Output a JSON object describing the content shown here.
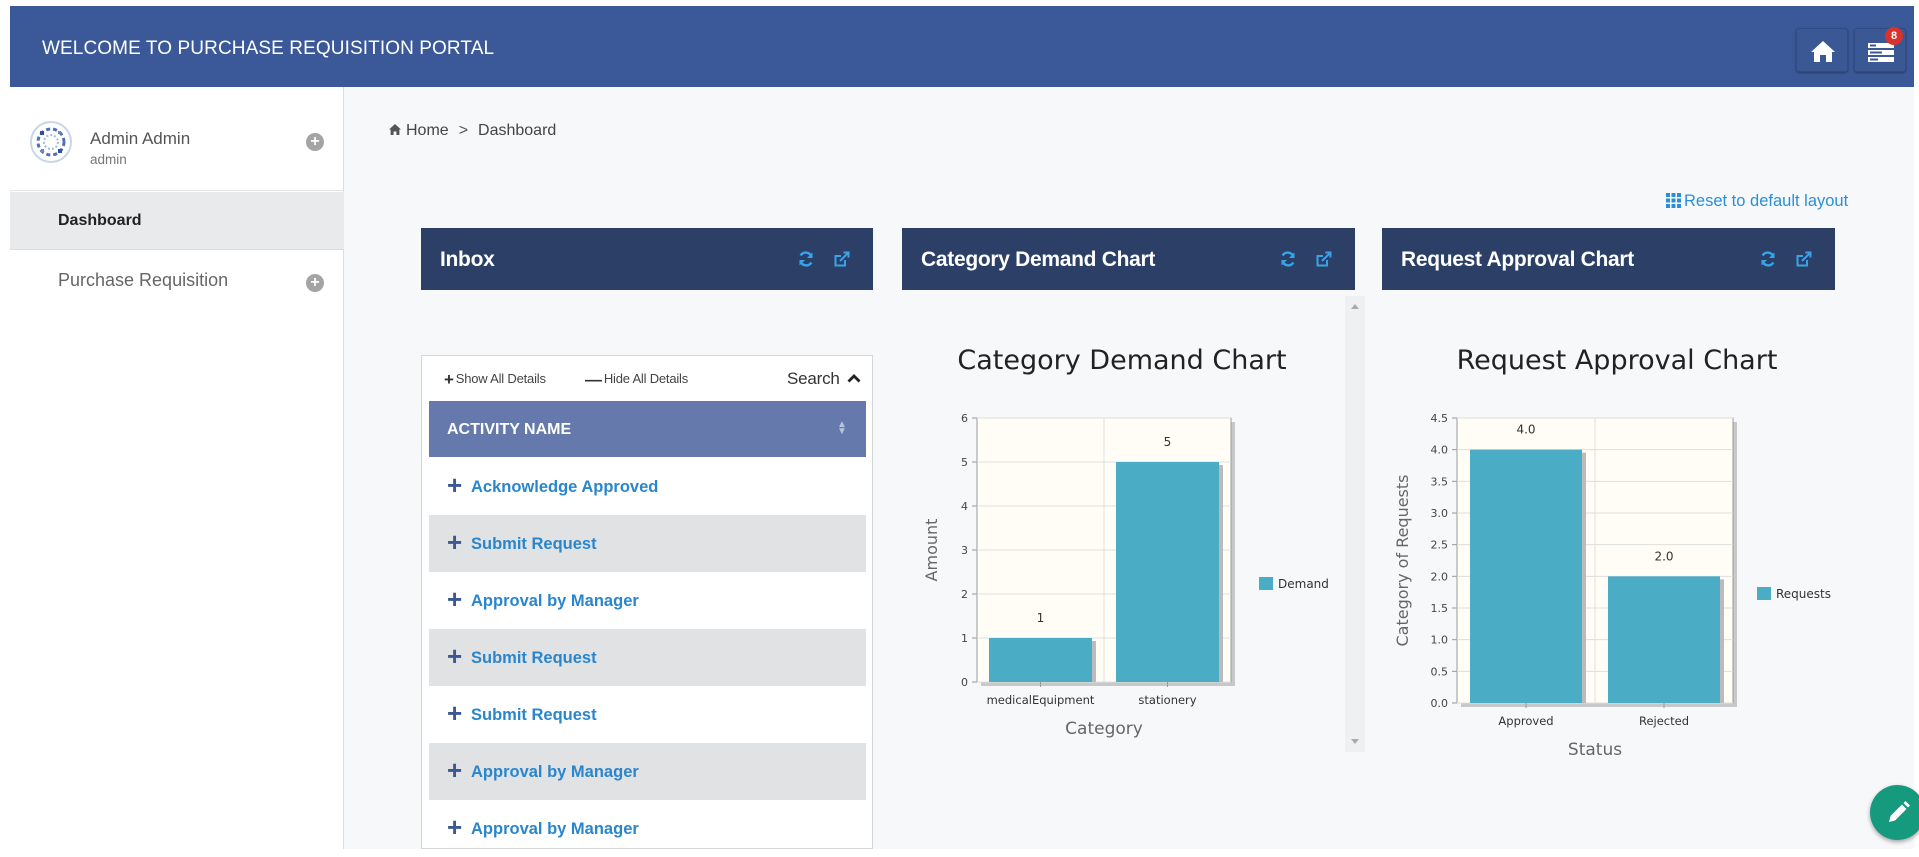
{
  "header": {
    "title": "WELCOME TO PURCHASE REQUISITION PORTAL",
    "notification_count": "8"
  },
  "sidebar": {
    "user": {
      "name": "Admin Admin",
      "role": "admin"
    },
    "items": [
      {
        "label": "Dashboard",
        "active": true
      },
      {
        "label": "Purchase Requisition",
        "active": false
      }
    ]
  },
  "breadcrumb": {
    "home": "Home",
    "current": "Dashboard"
  },
  "reset_layout": "Reset to default layout",
  "panels": {
    "inbox": {
      "title": "Inbox",
      "show_all": "Show All Details",
      "hide_all": "Hide All Details",
      "search": "Search",
      "column": "ACTIVITY NAME",
      "rows": [
        "Acknowledge Approved",
        "Submit Request",
        "Approval by Manager",
        "Submit Request",
        "Submit Request",
        "Approval by Manager",
        "Approval by Manager"
      ]
    },
    "category": {
      "title": "Category Demand Chart"
    },
    "approval": {
      "title": "Request Approval Chart"
    }
  },
  "colors": {
    "header": "#3b5998",
    "panel_header": "#2c4067",
    "bar": "#4bacc6",
    "link": "#2a86cc",
    "fab": "#159a7e"
  },
  "icons": [
    "home-icon",
    "tasks-icon",
    "refresh-icon",
    "external-link-icon",
    "th-icon",
    "plus-icon",
    "pencil-icon"
  ],
  "chart_data": [
    {
      "type": "bar",
      "title": "Category Demand Chart",
      "categories": [
        "medicalEquipment",
        "stationery"
      ],
      "series": [
        {
          "name": "Demand",
          "values": [
            1,
            5
          ]
        }
      ],
      "data_labels": [
        "1",
        "5"
      ],
      "xlabel": "Category",
      "ylabel": "Amount",
      "ylim": [
        0,
        6
      ],
      "yticks": [
        "0",
        "1",
        "2",
        "3",
        "4",
        "5",
        "6"
      ],
      "grid": true,
      "legend": "right"
    },
    {
      "type": "bar",
      "title": "Request Approval Chart",
      "categories": [
        "Approved",
        "Rejected"
      ],
      "series": [
        {
          "name": "Requests",
          "values": [
            4.0,
            2.0
          ]
        }
      ],
      "data_labels": [
        "4.0",
        "2.0"
      ],
      "xlabel": "Status",
      "ylabel": "Category of Requests",
      "ylim": [
        0,
        4.5
      ],
      "yticks": [
        "0.0",
        "0.5",
        "1.0",
        "1.5",
        "2.0",
        "2.5",
        "3.0",
        "3.5",
        "4.0",
        "4.5"
      ],
      "grid": true,
      "legend": "right"
    }
  ]
}
